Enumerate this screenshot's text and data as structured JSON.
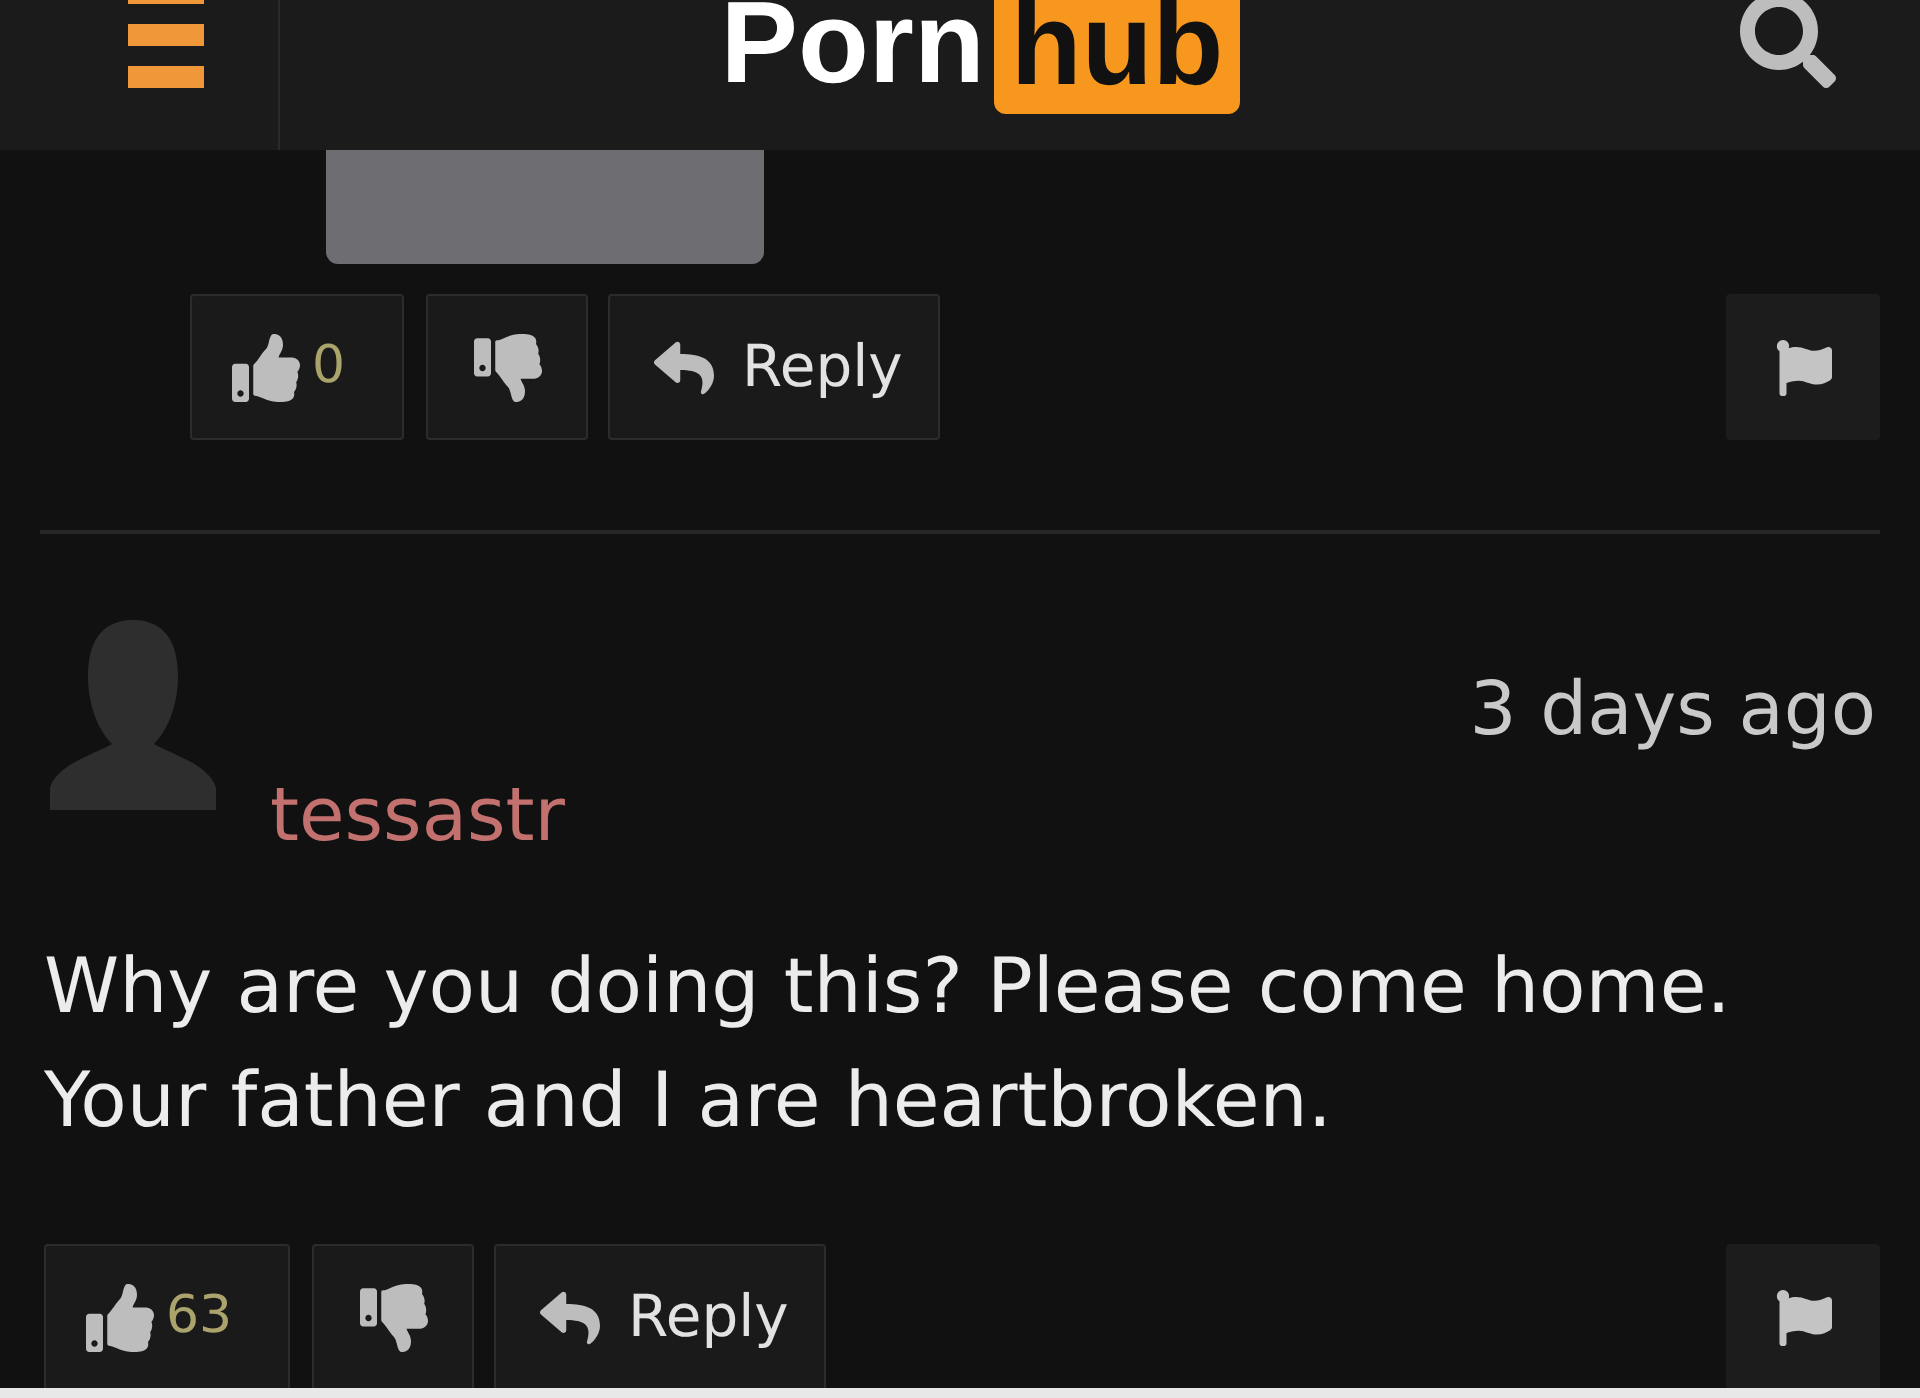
{
  "header": {
    "logo": [
      "Porn",
      "hub"
    ]
  },
  "comments": [
    {
      "kind": "reply",
      "redacted": true,
      "likes": "0",
      "reply_label": "Reply"
    },
    {
      "kind": "comment",
      "username": "tessastr",
      "time": "3 days ago",
      "text": "Why are you doing this? Please come home. Your father and I are heartbroken.",
      "likes": "63",
      "reply_label": "Reply"
    }
  ]
}
